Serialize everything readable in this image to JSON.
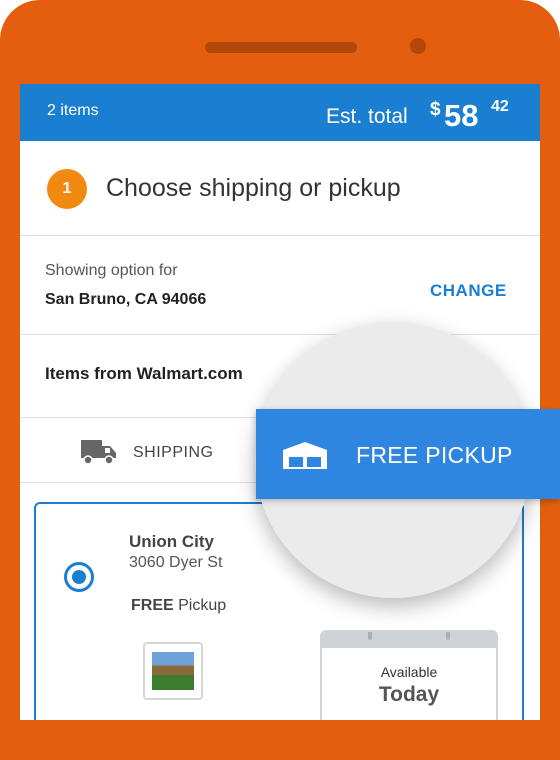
{
  "cart": {
    "items_label": "2 items",
    "est_total_label": "Est. total",
    "currency": "$",
    "total_main": "58",
    "total_cents": "42"
  },
  "step": {
    "number": "1",
    "title": "Choose shipping or pickup"
  },
  "location": {
    "showing_label": "Showing option for",
    "zip": "San Bruno, CA 94066",
    "change_label": "CHANGE"
  },
  "seller": {
    "label": "Items from Walmart.com"
  },
  "tabs": {
    "shipping_label": "SHIPPING",
    "pickup_label": "FREE PICKUP",
    "selected": "pickup"
  },
  "store": {
    "name": "Union City",
    "address": "3060 Dyer St",
    "pickup_free": "FREE",
    "pickup_word": "Pickup",
    "availability_label": "Available",
    "availability_value": "Today",
    "selected": true
  },
  "colors": {
    "brand_orange": "#e35f0f",
    "walmart_blue": "#1a7fd0",
    "pickup_blue": "#2e86e0",
    "step_badge": "#f28a12"
  },
  "icons": [
    "truck-icon",
    "store-icon",
    "calendar-icon"
  ]
}
